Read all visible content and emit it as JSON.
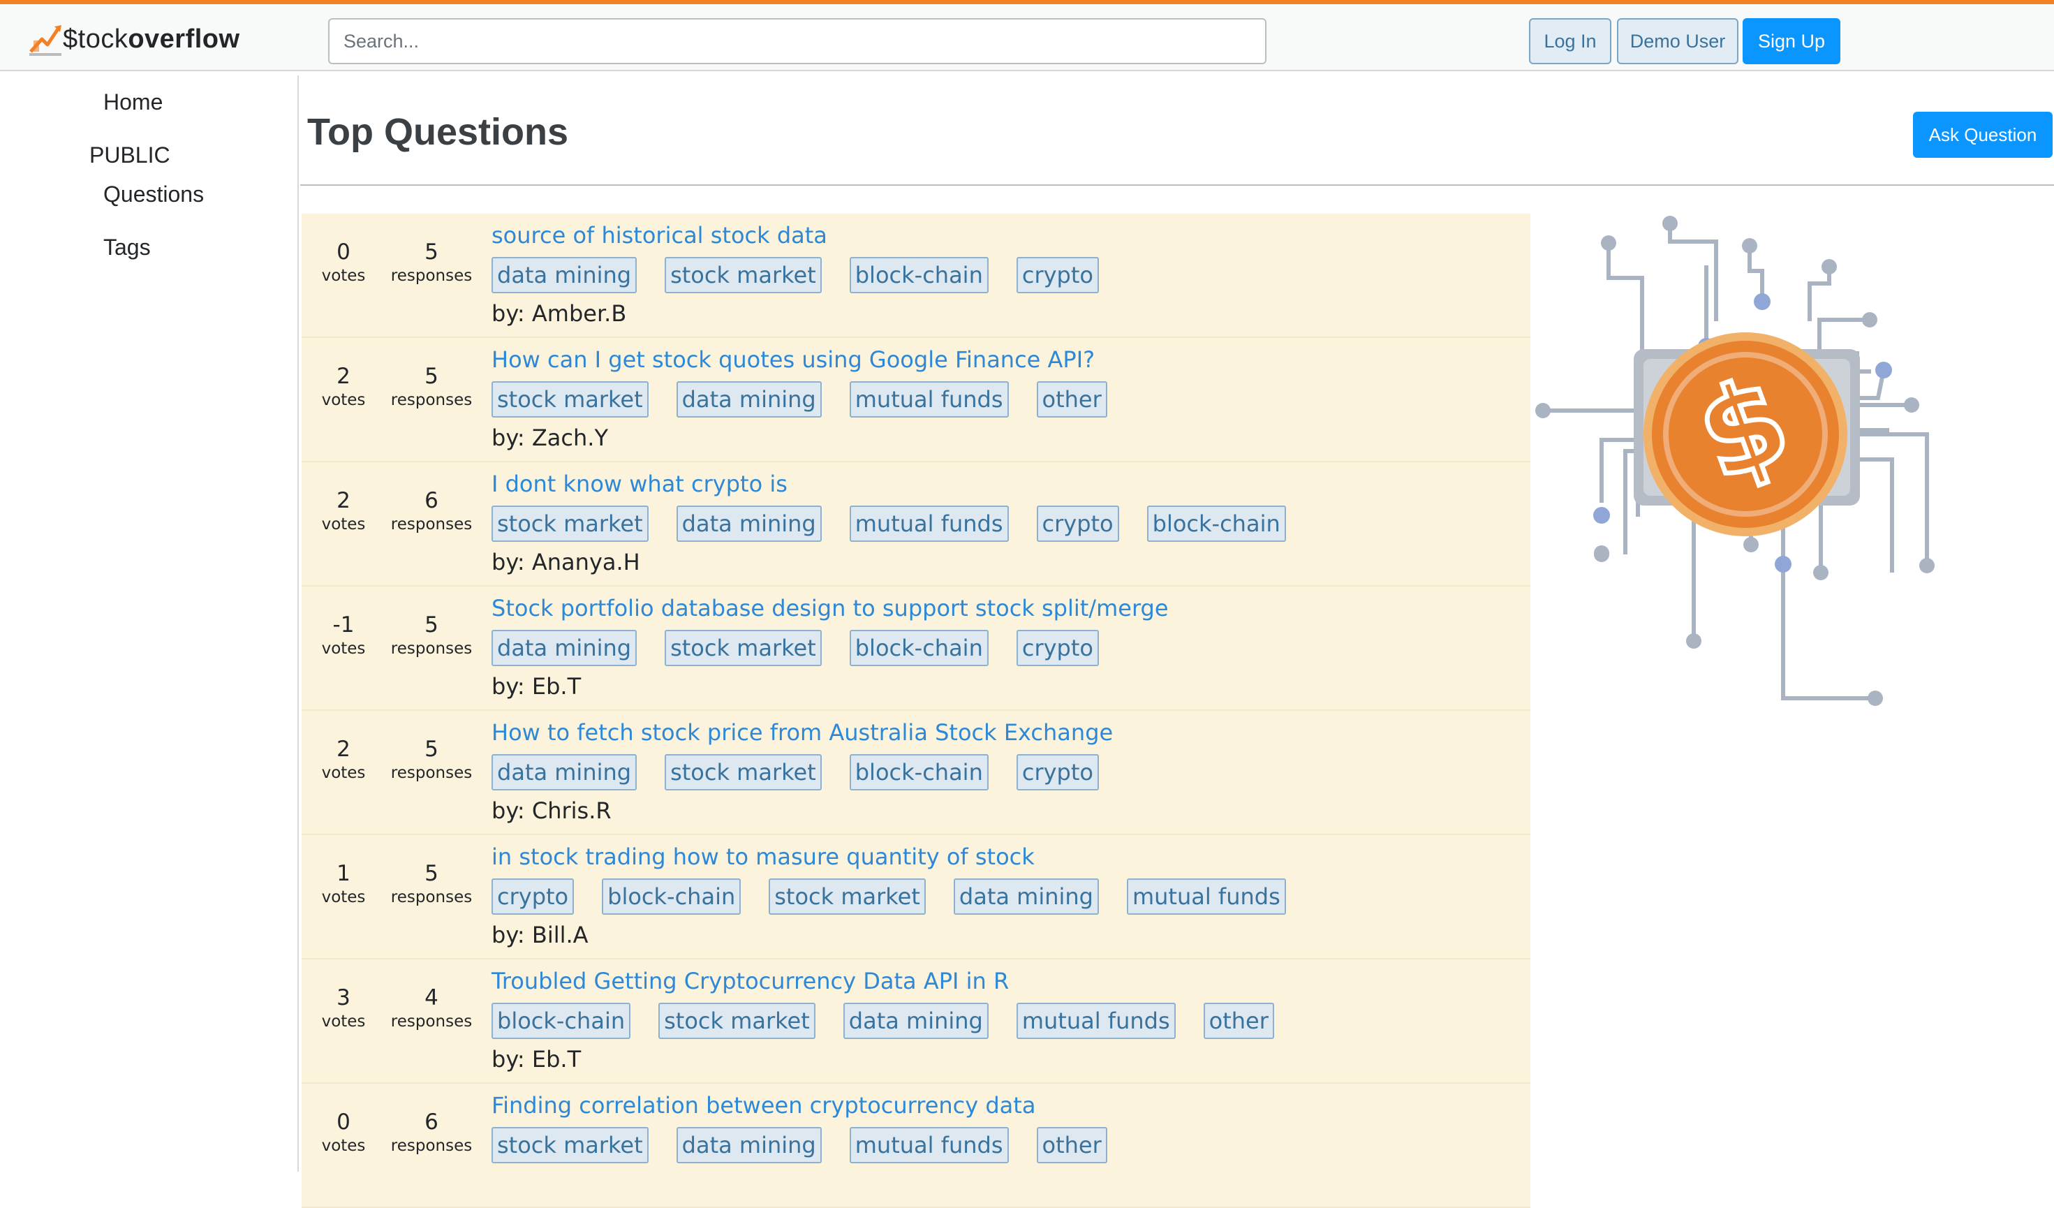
{
  "header": {
    "logo_text_prefix": "$tock",
    "logo_text_suffix": "overflow",
    "search_placeholder": "Search...",
    "login_label": "Log In",
    "demo_label": "Demo User",
    "signup_label": "Sign Up"
  },
  "sidebar": {
    "home": "Home",
    "public_heading": "PUBLIC",
    "questions": "Questions",
    "tags": "Tags"
  },
  "main": {
    "title": "Top Questions",
    "ask_label": "Ask Question",
    "votes_label": "votes",
    "responses_label": "responses",
    "questions": [
      {
        "votes": "0",
        "responses": "5",
        "title": "source of historical stock data",
        "tags": [
          "data mining",
          "stock market",
          "block-chain",
          "crypto"
        ],
        "author": "by: Amber.B"
      },
      {
        "votes": "2",
        "responses": "5",
        "title": "How can I get stock quotes using Google Finance API?",
        "tags": [
          "stock market",
          "data mining",
          "mutual funds",
          "other"
        ],
        "author": "by: Zach.Y"
      },
      {
        "votes": "2",
        "responses": "6",
        "title": "I dont know what crypto is",
        "tags": [
          "stock market",
          "data mining",
          "mutual funds",
          "crypto",
          "block-chain"
        ],
        "author": "by: Ananya.H"
      },
      {
        "votes": "-1",
        "responses": "5",
        "title": "Stock portfolio database design to support stock split/merge",
        "tags": [
          "data mining",
          "stock market",
          "block-chain",
          "crypto"
        ],
        "author": "by: Eb.T"
      },
      {
        "votes": "2",
        "responses": "5",
        "title": "How to fetch stock price from Australia Stock Exchange",
        "tags": [
          "data mining",
          "stock market",
          "block-chain",
          "crypto"
        ],
        "author": "by: Chris.R"
      },
      {
        "votes": "1",
        "responses": "5",
        "title": "in stock trading how to masure quantity of stock",
        "tags": [
          "crypto",
          "block-chain",
          "stock market",
          "data mining",
          "mutual funds"
        ],
        "author": "by: Bill.A"
      },
      {
        "votes": "3",
        "responses": "4",
        "title": "Troubled Getting Cryptocurrency Data API in R",
        "tags": [
          "block-chain",
          "stock market",
          "data mining",
          "mutual funds",
          "other"
        ],
        "author": "by: Eb.T"
      },
      {
        "votes": "0",
        "responses": "6",
        "title": "Finding correlation between cryptocurrency data",
        "tags": [
          "stock market",
          "data mining",
          "mutual funds",
          "other"
        ],
        "author": ""
      }
    ]
  },
  "colors": {
    "accent_orange": "#f48024",
    "link_blue": "#2e88d8",
    "button_blue": "#0a95ff",
    "row_background": "#fbf3dc",
    "coin_orange": "#e8822f"
  },
  "icons": {
    "logo": "stock-chart-logo-icon",
    "illustration": "circuit-dollar-coin-illustration"
  }
}
